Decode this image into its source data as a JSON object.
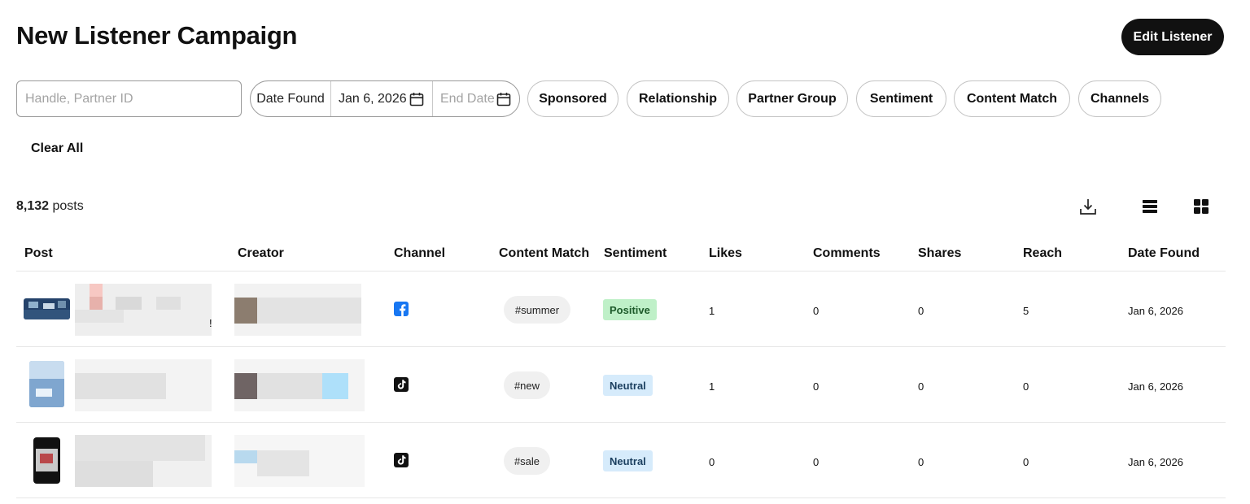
{
  "header": {
    "title": "New Listener Campaign",
    "edit_label": "Edit Listener"
  },
  "filters": {
    "search_placeholder": "Handle, Partner ID",
    "date_label": "Date Found",
    "start_date": "Jan 6, 2026",
    "end_placeholder": "End Date",
    "chips": [
      "Sponsored",
      "Relationship",
      "Partner Group",
      "Sentiment",
      "Content Match",
      "Channels"
    ],
    "clear_all": "Clear All"
  },
  "results": {
    "count": "8,132",
    "count_suffix": "posts"
  },
  "table": {
    "columns": [
      "Post",
      "Creator",
      "Channel",
      "Content Match",
      "Sentiment",
      "Likes",
      "Comments",
      "Shares",
      "Reach",
      "Date Found"
    ],
    "rows": [
      {
        "channel": "facebook",
        "content_match": "#summer",
        "sentiment": "Positive",
        "likes": "1",
        "comments": "0",
        "shares": "0",
        "reach": "5",
        "date_found": "Jan 6, 2026",
        "post_trailing": "!"
      },
      {
        "channel": "tiktok",
        "content_match": "#new",
        "sentiment": "Neutral",
        "likes": "1",
        "comments": "0",
        "shares": "0",
        "reach": "0",
        "date_found": "Jan 6, 2026"
      },
      {
        "channel": "tiktok",
        "content_match": "#sale",
        "sentiment": "Neutral",
        "likes": "0",
        "comments": "0",
        "shares": "0",
        "reach": "0",
        "date_found": "Jan 6, 2026"
      }
    ]
  },
  "icons": {
    "calendar": "calendar-icon",
    "download": "download-icon",
    "list_view": "list-view-icon",
    "grid_view": "grid-view-icon",
    "facebook": "facebook-icon",
    "tiktok": "tiktok-icon"
  },
  "colors": {
    "primary": "#111111",
    "positive_bg": "#bff0c8",
    "neutral_bg": "#d6ebfb",
    "facebook": "#1877f2"
  }
}
